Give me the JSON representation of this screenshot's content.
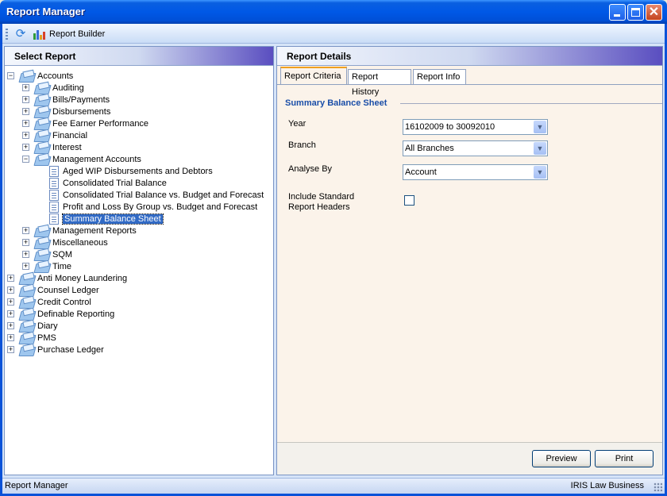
{
  "window": {
    "title": "Report Manager"
  },
  "toolbar": {
    "refresh_icon": "refresh-icon",
    "report_builder_label": "Report Builder"
  },
  "left_panel": {
    "header": "Select Report",
    "tree": [
      {
        "label": "Accounts",
        "level": 0,
        "type": "folder",
        "expanded": true
      },
      {
        "label": "Auditing",
        "level": 1,
        "type": "folder",
        "expanded": false
      },
      {
        "label": "Bills/Payments",
        "level": 1,
        "type": "folder",
        "expanded": false
      },
      {
        "label": "Disbursements",
        "level": 1,
        "type": "folder",
        "expanded": false
      },
      {
        "label": "Fee Earner Performance",
        "level": 1,
        "type": "folder",
        "expanded": false
      },
      {
        "label": "Financial",
        "level": 1,
        "type": "folder",
        "expanded": false
      },
      {
        "label": "Interest",
        "level": 1,
        "type": "folder",
        "expanded": false
      },
      {
        "label": "Management Accounts",
        "level": 1,
        "type": "folder",
        "expanded": true
      },
      {
        "label": "Aged WIP Disbursements and Debtors",
        "level": 2,
        "type": "report"
      },
      {
        "label": "Consolidated Trial Balance",
        "level": 2,
        "type": "report"
      },
      {
        "label": "Consolidated Trial Balance vs. Budget and Forecast",
        "level": 2,
        "type": "report"
      },
      {
        "label": "Profit and Loss By Group vs. Budget and Forecast",
        "level": 2,
        "type": "report"
      },
      {
        "label": "Summary Balance Sheet",
        "level": 2,
        "type": "report",
        "selected": true
      },
      {
        "label": "Management Reports",
        "level": 1,
        "type": "folder",
        "expanded": false
      },
      {
        "label": "Miscellaneous",
        "level": 1,
        "type": "folder",
        "expanded": false
      },
      {
        "label": "SQM",
        "level": 1,
        "type": "folder",
        "expanded": false
      },
      {
        "label": "Time",
        "level": 1,
        "type": "folder",
        "expanded": false
      },
      {
        "label": "Anti Money Laundering",
        "level": 0,
        "type": "folder",
        "expanded": false
      },
      {
        "label": "Counsel Ledger",
        "level": 0,
        "type": "folder",
        "expanded": false
      },
      {
        "label": "Credit Control",
        "level": 0,
        "type": "folder",
        "expanded": false
      },
      {
        "label": "Definable Reporting",
        "level": 0,
        "type": "folder",
        "expanded": false
      },
      {
        "label": "Diary",
        "level": 0,
        "type": "folder",
        "expanded": false
      },
      {
        "label": "PMS",
        "level": 0,
        "type": "folder",
        "expanded": false
      },
      {
        "label": "Purchase Ledger",
        "level": 0,
        "type": "folder",
        "expanded": false
      }
    ]
  },
  "right_panel": {
    "header": "Report Details",
    "tabs": [
      {
        "label": "Report Criteria",
        "active": true
      },
      {
        "label": "Report History",
        "active": false
      },
      {
        "label": "Report Info",
        "active": false
      }
    ],
    "section_title": "Summary Balance Sheet",
    "fields": {
      "year": {
        "label": "Year",
        "value": "16102009 to 30092010"
      },
      "branch": {
        "label": "Branch",
        "value": "All Branches"
      },
      "analyse_by": {
        "label": "Analyse By",
        "value": "Account"
      },
      "include_headers": {
        "label_line1": "Include Standard",
        "label_line2": "Report Headers",
        "checked": false
      }
    },
    "buttons": {
      "preview": "Preview",
      "print": "Print"
    }
  },
  "status_bar": {
    "left": "Report Manager",
    "right": "IRIS Law Business"
  },
  "colors": {
    "titlebar": "#0058e6",
    "selection": "#316ac5",
    "section_title": "#1a4ea8",
    "active_tab_accent": "#f0a020"
  }
}
